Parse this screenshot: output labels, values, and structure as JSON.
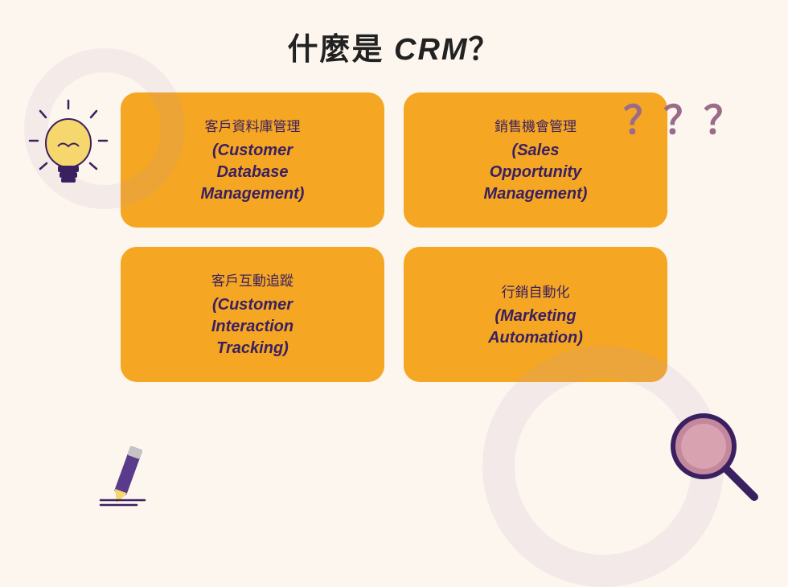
{
  "page": {
    "title_prefix": "什麼是 ",
    "title_bold": "CRM",
    "title_suffix": "？"
  },
  "cards": [
    {
      "id": "card-db-management",
      "chinese": "客戶資料庫管理",
      "english": "(Customer\nDatabase\nManagement)"
    },
    {
      "id": "card-sales-opportunity",
      "chinese": "銷售機會管理",
      "english": "(Sales\nOpportunity\nManagement)"
    },
    {
      "id": "card-interaction-tracking",
      "chinese": "客戶互動追蹤",
      "english": "(Customer\nInteraction\nTracking)"
    },
    {
      "id": "card-marketing-automation",
      "chinese": "行銷自動化",
      "english": "(Marketing\nAutomation)"
    }
  ],
  "decorations": {
    "question_marks": "？？？",
    "accent_color": "#f5a623",
    "dark_color": "#3a2060"
  }
}
